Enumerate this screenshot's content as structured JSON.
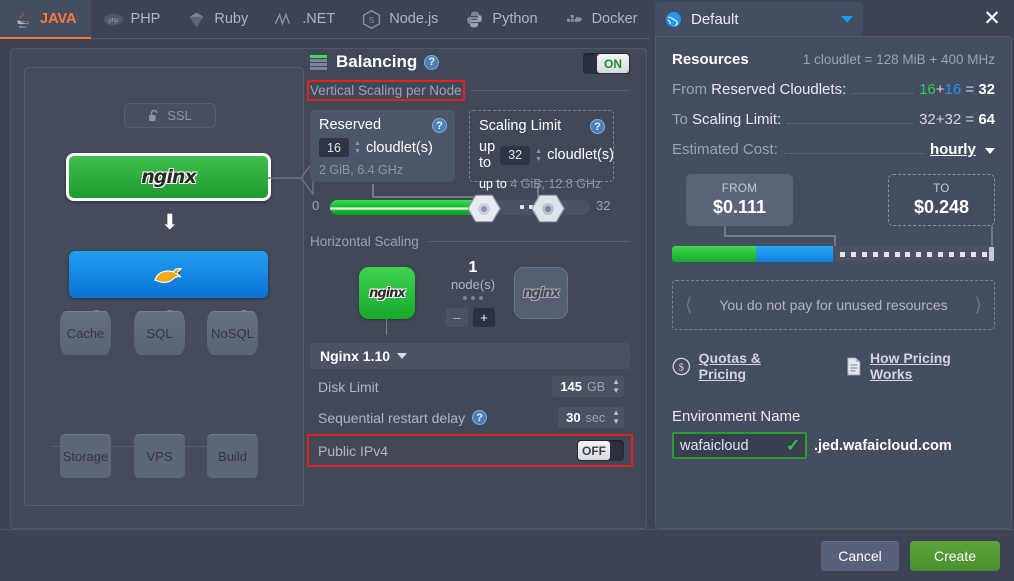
{
  "tabs": [
    {
      "label": "JAVA",
      "icon": "java-icon",
      "active": true
    },
    {
      "label": "PHP",
      "icon": "php-icon",
      "active": false
    },
    {
      "label": "Ruby",
      "icon": "ruby-icon",
      "active": false
    },
    {
      "label": ".NET",
      "icon": "dotnet-icon",
      "active": false
    },
    {
      "label": "Node.js",
      "icon": "nodejs-icon",
      "active": false
    },
    {
      "label": "Python",
      "icon": "python-icon",
      "active": false
    },
    {
      "label": "Docker",
      "icon": "docker-icon",
      "active": false
    }
  ],
  "topology": {
    "ssl_badge": "SSL",
    "balancer_label": "nginx",
    "app_server_icon": "tomcat-icon",
    "databases": [
      "Cache",
      "SQL",
      "NoSQL"
    ],
    "extras": [
      "Storage",
      "VPS",
      "Build"
    ]
  },
  "settings": {
    "section_title": "Balancing",
    "toggle_label": "ON",
    "vertical_scaling_label": "Vertical Scaling per Node",
    "reserved": {
      "title": "Reserved",
      "value": "16",
      "unit": "cloudlet(s)",
      "sub": "2 GiB, 6.4 GHz"
    },
    "scaling_limit": {
      "title": "Scaling Limit",
      "prefix": "up to",
      "value": "32",
      "unit": "cloudlet(s)",
      "sub_prefix": "up to",
      "sub": "4 GiB, 12.8 GHz"
    },
    "slider": {
      "min": "0",
      "max": "32"
    },
    "horizontal_scaling_label": "Horizontal Scaling",
    "nodes": {
      "count": "1",
      "unit": "node(s)",
      "minus": "–",
      "plus": "+",
      "node_label": "nginx"
    },
    "stack_select": "Nginx 1.10",
    "disk_limit": {
      "label": "Disk Limit",
      "value": "145",
      "unit": "GB"
    },
    "restart_delay": {
      "label": "Sequential restart delay",
      "value": "30",
      "unit": "sec"
    },
    "public_ipv4": {
      "label": "Public IPv4",
      "toggle": "OFF"
    }
  },
  "right_panel": {
    "tab_title": "Default",
    "resources_title": "Resources",
    "cloudlet_note": "1 cloudlet = 128 MiB + 400 MHz",
    "from_reserved": {
      "label_prefix": "From ",
      "label": "Reserved Cloudlets:",
      "a": "16",
      "plus": "+",
      "b": "16",
      "eq": "=",
      "total": "32"
    },
    "to_limit": {
      "label_prefix": "To ",
      "label": "Scaling Limit:",
      "a": "32",
      "plus": "+",
      "b": "32",
      "eq": "=",
      "total": "64"
    },
    "estimated_cost": {
      "label": "Estimated Cost:",
      "period": "hourly"
    },
    "from_card": {
      "caption": "FROM",
      "amount": "$0.111"
    },
    "to_card": {
      "caption": "TO",
      "amount": "$0.248"
    },
    "note": "You do not pay for unused resources",
    "links": [
      {
        "label": "Quotas & Pricing",
        "icon": "dollar-circle-icon"
      },
      {
        "label": "How Pricing Works",
        "icon": "document-icon"
      }
    ],
    "env_name_label": "Environment Name",
    "env_name_value": "wafaicloud",
    "env_domain_suffix": ".jed.wafaicloud.com"
  },
  "footer": {
    "cancel": "Cancel",
    "create": "Create"
  },
  "colors": {
    "accent_orange": "#ff7a33",
    "green": "#2fcc45",
    "blue": "#2196f3",
    "highlight_red": "#e52020",
    "panel": "#454d60",
    "background": "#3c4354"
  }
}
